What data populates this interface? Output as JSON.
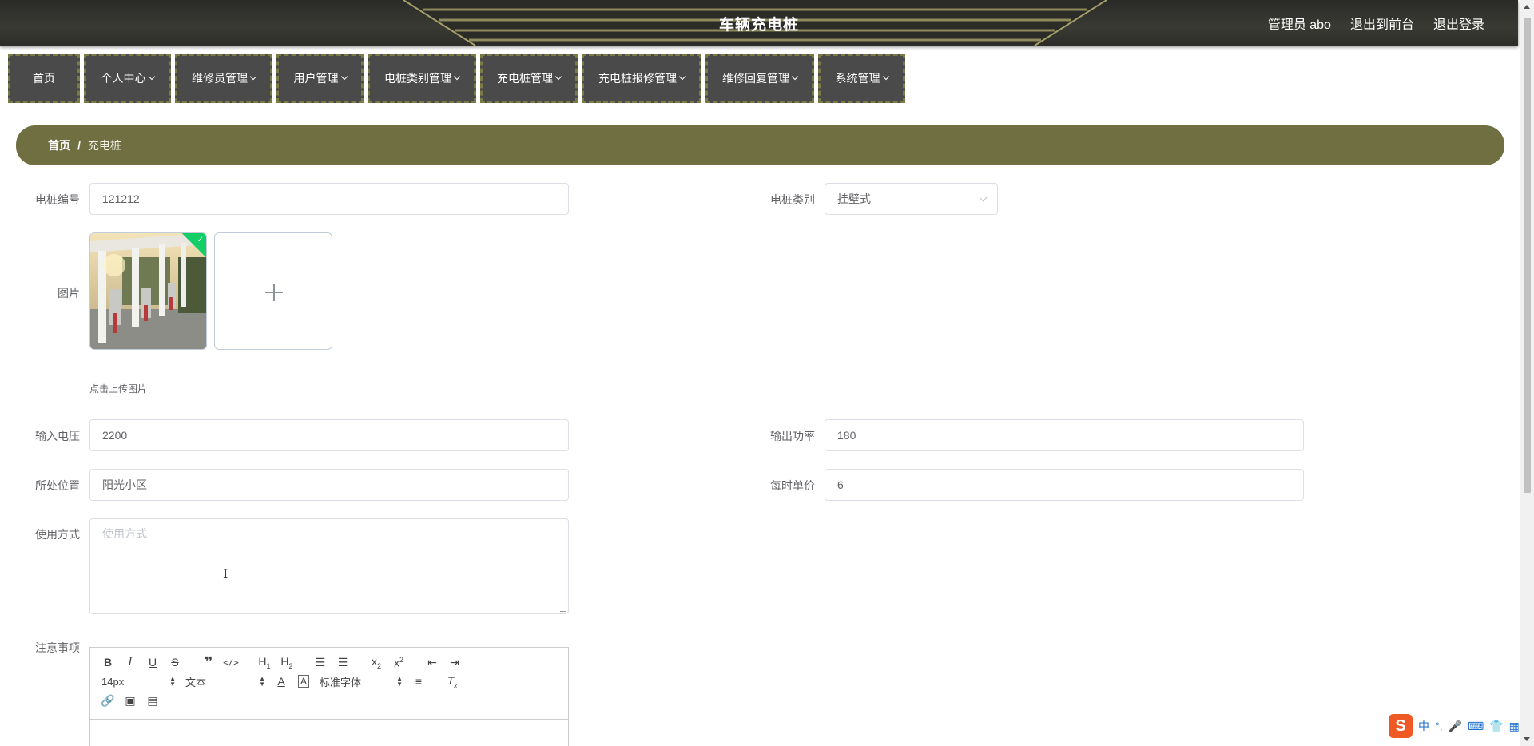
{
  "header": {
    "title": "车辆充电桩",
    "links": [
      "管理员 abo",
      "退出到前台",
      "退出登录"
    ]
  },
  "nav": [
    {
      "label": "首页",
      "dropdown": false
    },
    {
      "label": "个人中心",
      "dropdown": true
    },
    {
      "label": "维修员管理",
      "dropdown": true
    },
    {
      "label": "用户管理",
      "dropdown": true
    },
    {
      "label": "电桩类别管理",
      "dropdown": true
    },
    {
      "label": "充电桩管理",
      "dropdown": true
    },
    {
      "label": "充电桩报修管理",
      "dropdown": true
    },
    {
      "label": "维修回复管理",
      "dropdown": true
    },
    {
      "label": "系统管理",
      "dropdown": true
    }
  ],
  "breadcrumb": {
    "home": "首页",
    "separator": "/",
    "current": "充电桩"
  },
  "form": {
    "pile_no": {
      "label": "电桩编号",
      "value": "121212"
    },
    "category": {
      "label": "电桩类别",
      "value": "挂壁式"
    },
    "image": {
      "label": "图片",
      "tip": "点击上传图片"
    },
    "input_voltage": {
      "label": "输入电压",
      "value": "2200"
    },
    "output_power": {
      "label": "输出功率",
      "value": "180"
    },
    "location": {
      "label": "所处位置",
      "value": "阳光小区"
    },
    "hourly_price": {
      "label": "每时单价",
      "value": "6"
    },
    "usage": {
      "label": "使用方式",
      "placeholder": "使用方式"
    },
    "notes": {
      "label": "注意事项"
    }
  },
  "editor": {
    "font_size": "14px",
    "text_type": "文本",
    "font_family": "标准字体"
  },
  "colors": {
    "accent": "#6f6f42",
    "nav_bg": "#4a4a4a",
    "header_bg": "#2e2e2b",
    "success": "#13ce66"
  },
  "ime": {
    "lang": "中"
  }
}
